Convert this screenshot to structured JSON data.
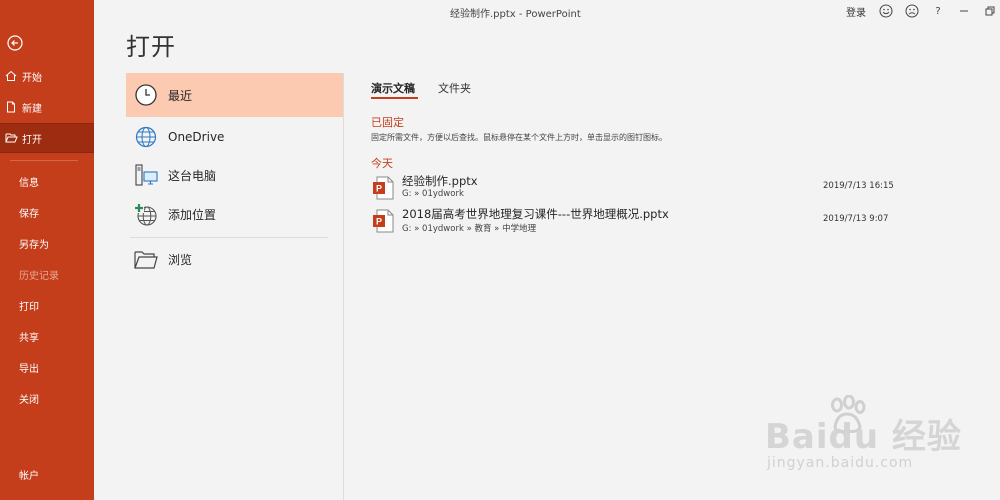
{
  "window": {
    "title": "经验制作.pptx  -  PowerPoint",
    "login": "登录",
    "help": "?"
  },
  "nav": {
    "items": [
      {
        "label": "开始",
        "icon": "home-icon"
      },
      {
        "label": "新建",
        "icon": "new-file-icon"
      },
      {
        "label": "打开",
        "icon": "open-folder-icon",
        "active": true
      },
      {
        "label": "信息"
      },
      {
        "label": "保存"
      },
      {
        "label": "另存为"
      },
      {
        "label": "历史记录",
        "disabled": true
      },
      {
        "label": "打印"
      },
      {
        "label": "共享"
      },
      {
        "label": "导出"
      },
      {
        "label": "关闭"
      },
      {
        "label": "帐户"
      }
    ]
  },
  "page": {
    "title": "打开"
  },
  "places": [
    {
      "label": "最近",
      "icon": "clock-icon",
      "selected": true
    },
    {
      "label": "OneDrive",
      "icon": "globe-icon"
    },
    {
      "label": "这台电脑",
      "icon": "computer-icon"
    },
    {
      "label": "添加位置",
      "icon": "add-location-icon"
    },
    {
      "label": "浏览",
      "icon": "folder-icon"
    }
  ],
  "tabs": [
    {
      "label": "演示文稿",
      "active": true
    },
    {
      "label": "文件夹"
    }
  ],
  "pinned": {
    "title": "已固定",
    "hint": "固定所需文件，方便以后查找。鼠标悬停在某个文件上方时，单击显示的图钉图标。"
  },
  "today": {
    "title": "今天",
    "files": [
      {
        "name": "经验制作.pptx",
        "path": "G: » 01ydwork",
        "date": "2019/7/13 16:15"
      },
      {
        "name": "2018届高考世界地理复习课件---世界地理概况.pptx",
        "path": "G: » 01ydwork » 教育 » 中学地理",
        "date": "2019/7/13 9:07"
      }
    ]
  },
  "watermark": {
    "text": "Baidu 经验",
    "url": "jingyan.baidu.com"
  },
  "colors": {
    "accent": "#c43e1c",
    "selected": "#fcc9b1"
  }
}
